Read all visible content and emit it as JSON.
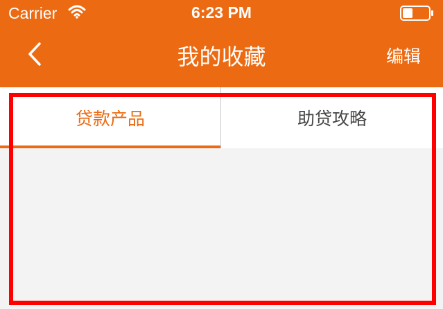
{
  "status_bar": {
    "carrier": "Carrier",
    "time": "6:23 PM",
    "icons": [
      "wifi-icon",
      "battery-icon"
    ]
  },
  "nav": {
    "title": "我的收藏",
    "edit_label": "编辑",
    "back_icon": "chevron-left-icon"
  },
  "tabs": [
    {
      "label": "贷款产品",
      "active": true
    },
    {
      "label": "助贷攻略",
      "active": false
    }
  ],
  "colors": {
    "accent": "#ec6a12",
    "active_tab_text": "#ec6a12",
    "inactive_tab_text": "#444444",
    "content_background": "#f3f3f3",
    "highlight_border": "#ff0000"
  }
}
